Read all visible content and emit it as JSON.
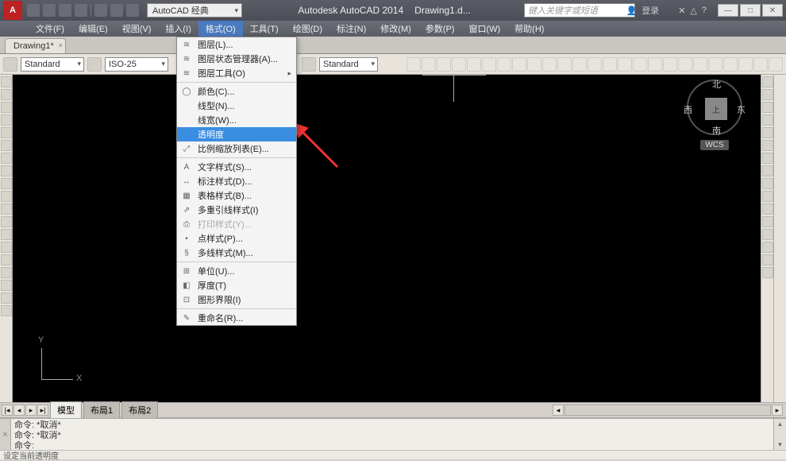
{
  "title": {
    "app": "Autodesk AutoCAD 2014",
    "doc": "Drawing1.d..."
  },
  "workspace": "AutoCAD 经典",
  "search_placeholder": "键入关键字或短语",
  "login_label": "登录",
  "menubar": [
    "文件(F)",
    "编辑(E)",
    "视图(V)",
    "插入(I)",
    "格式(O)",
    "工具(T)",
    "绘图(D)",
    "标注(N)",
    "修改(M)",
    "参数(P)",
    "窗口(W)",
    "帮助(H)"
  ],
  "active_menu_index": 4,
  "tabs": [
    "Drawing1*"
  ],
  "style_dd1": "Standard",
  "style_dd2": "ISO-25",
  "style_dd3": "Standard",
  "dropdown": {
    "groups": [
      [
        {
          "icon": "≋",
          "label": "图层(L)..."
        },
        {
          "icon": "≋",
          "label": "图层状态管理器(A)..."
        },
        {
          "icon": "≋",
          "label": "图层工具(O)",
          "submenu": true
        }
      ],
      [
        {
          "icon": "◯",
          "label": "颜色(C)..."
        },
        {
          "icon": "",
          "label": "线型(N)..."
        },
        {
          "icon": "",
          "label": "线宽(W)..."
        },
        {
          "icon": "",
          "label": "透明度",
          "highlight": true
        },
        {
          "icon": "⤢",
          "label": "比例缩放列表(E)..."
        }
      ],
      [
        {
          "icon": "A",
          "label": "文字样式(S)..."
        },
        {
          "icon": "↔",
          "label": "标注样式(D)..."
        },
        {
          "icon": "▦",
          "label": "表格样式(B)..."
        },
        {
          "icon": "⇗",
          "label": "多重引线样式(I)"
        },
        {
          "icon": "⎙",
          "label": "打印样式(Y)...",
          "disabled": true
        },
        {
          "icon": "•",
          "label": "点样式(P)..."
        },
        {
          "icon": "§",
          "label": "多线样式(M)..."
        }
      ],
      [
        {
          "icon": "⊞",
          "label": "单位(U)..."
        },
        {
          "icon": "◧",
          "label": "厚度(T)"
        },
        {
          "icon": "⊡",
          "label": "图形界限(I)"
        }
      ],
      [
        {
          "icon": "✎",
          "label": "重命名(R)..."
        }
      ]
    ]
  },
  "ucs": {
    "y": "Y",
    "x": "X"
  },
  "viewcube": {
    "n": "北",
    "s": "南",
    "e": "东",
    "w": "西",
    "top": "上",
    "wcs": "WCS"
  },
  "layout_tabs": [
    "模型",
    "布局1",
    "布局2"
  ],
  "command_lines": [
    "命令: *取消*",
    "命令: *取消*",
    "命令:"
  ],
  "status_text": "设定当前透明度"
}
